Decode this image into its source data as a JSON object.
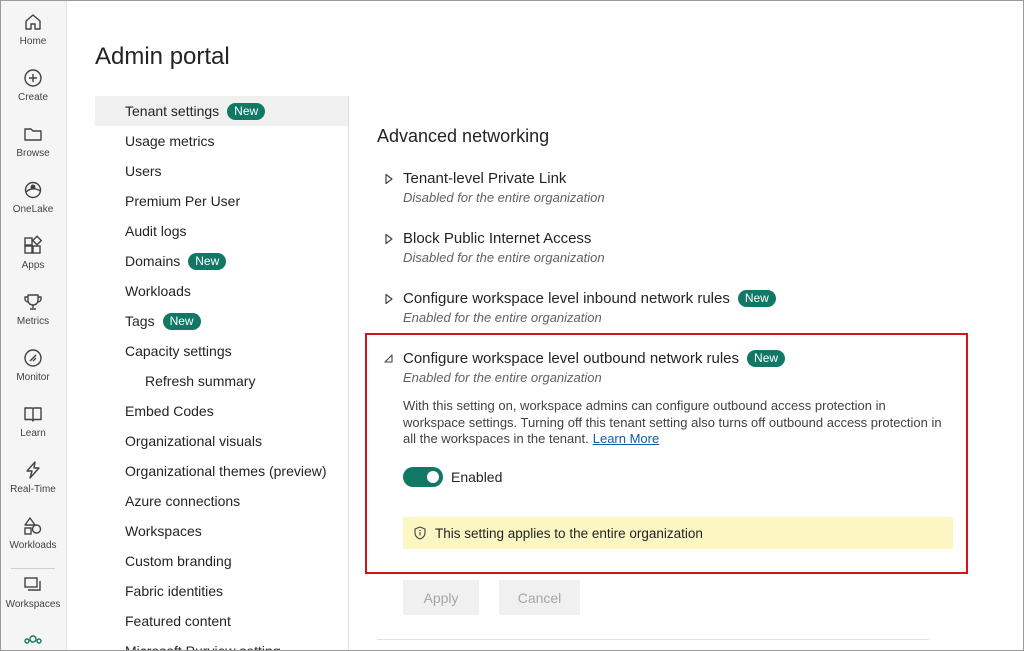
{
  "rail": [
    {
      "label": "Home",
      "icon": "home-icon"
    },
    {
      "label": "Create",
      "icon": "plus-circle-icon"
    },
    {
      "label": "Browse",
      "icon": "folder-icon"
    },
    {
      "label": "OneLake",
      "icon": "onelake-icon"
    },
    {
      "label": "Apps",
      "icon": "apps-icon"
    },
    {
      "label": "Metrics",
      "icon": "trophy-icon"
    },
    {
      "label": "Monitor",
      "icon": "monitor-icon"
    },
    {
      "label": "Learn",
      "icon": "book-icon"
    },
    {
      "label": "Real-Time",
      "icon": "lightning-icon"
    },
    {
      "label": "Workloads",
      "icon": "workloads-icon"
    },
    {
      "label": "Workspaces",
      "icon": "workspaces-icon"
    }
  ],
  "page": {
    "title": "Admin portal"
  },
  "nav": {
    "new_badge": "New",
    "items": [
      {
        "label": "Tenant settings",
        "badge": true,
        "active": true
      },
      {
        "label": "Usage metrics"
      },
      {
        "label": "Users"
      },
      {
        "label": "Premium Per User"
      },
      {
        "label": "Audit logs"
      },
      {
        "label": "Domains",
        "badge": true
      },
      {
        "label": "Workloads"
      },
      {
        "label": "Tags",
        "badge": true
      },
      {
        "label": "Capacity settings"
      },
      {
        "label": "Refresh summary",
        "sub": true
      },
      {
        "label": "Embed Codes"
      },
      {
        "label": "Organizational visuals"
      },
      {
        "label": "Organizational themes (preview)"
      },
      {
        "label": "Azure connections"
      },
      {
        "label": "Workspaces"
      },
      {
        "label": "Custom branding"
      },
      {
        "label": "Fabric identities"
      },
      {
        "label": "Featured content"
      },
      {
        "label": "Microsoft Purview setting"
      }
    ]
  },
  "section": {
    "title": "Advanced networking"
  },
  "settings": [
    {
      "name": "Tenant-level Private Link",
      "status": "Disabled for the entire organization",
      "badge": false,
      "expanded": false
    },
    {
      "name": "Block Public Internet Access",
      "status": "Disabled for the entire organization",
      "badge": false,
      "expanded": false
    },
    {
      "name": "Configure workspace level inbound network rules",
      "status": "Enabled for the entire organization",
      "badge": true,
      "expanded": false
    },
    {
      "name": "Configure workspace level outbound network rules",
      "status": "Enabled for the entire organization",
      "badge": true,
      "expanded": true
    }
  ],
  "expanded": {
    "description": "With this setting on, workspace admins can configure outbound access protection in workspace settings. Turning off this tenant setting also turns off outbound access protection in all the workspaces in the tenant.",
    "learn_more": "Learn More",
    "toggle_label": "Enabled",
    "toggle_on": true,
    "info": "This setting applies to the entire organization"
  },
  "buttons": {
    "apply": "Apply",
    "cancel": "Cancel"
  },
  "colors": {
    "accent": "#117865",
    "highlight_border": "#d1141c",
    "info_bg": "#fbf6c2",
    "link": "#115ea3"
  }
}
